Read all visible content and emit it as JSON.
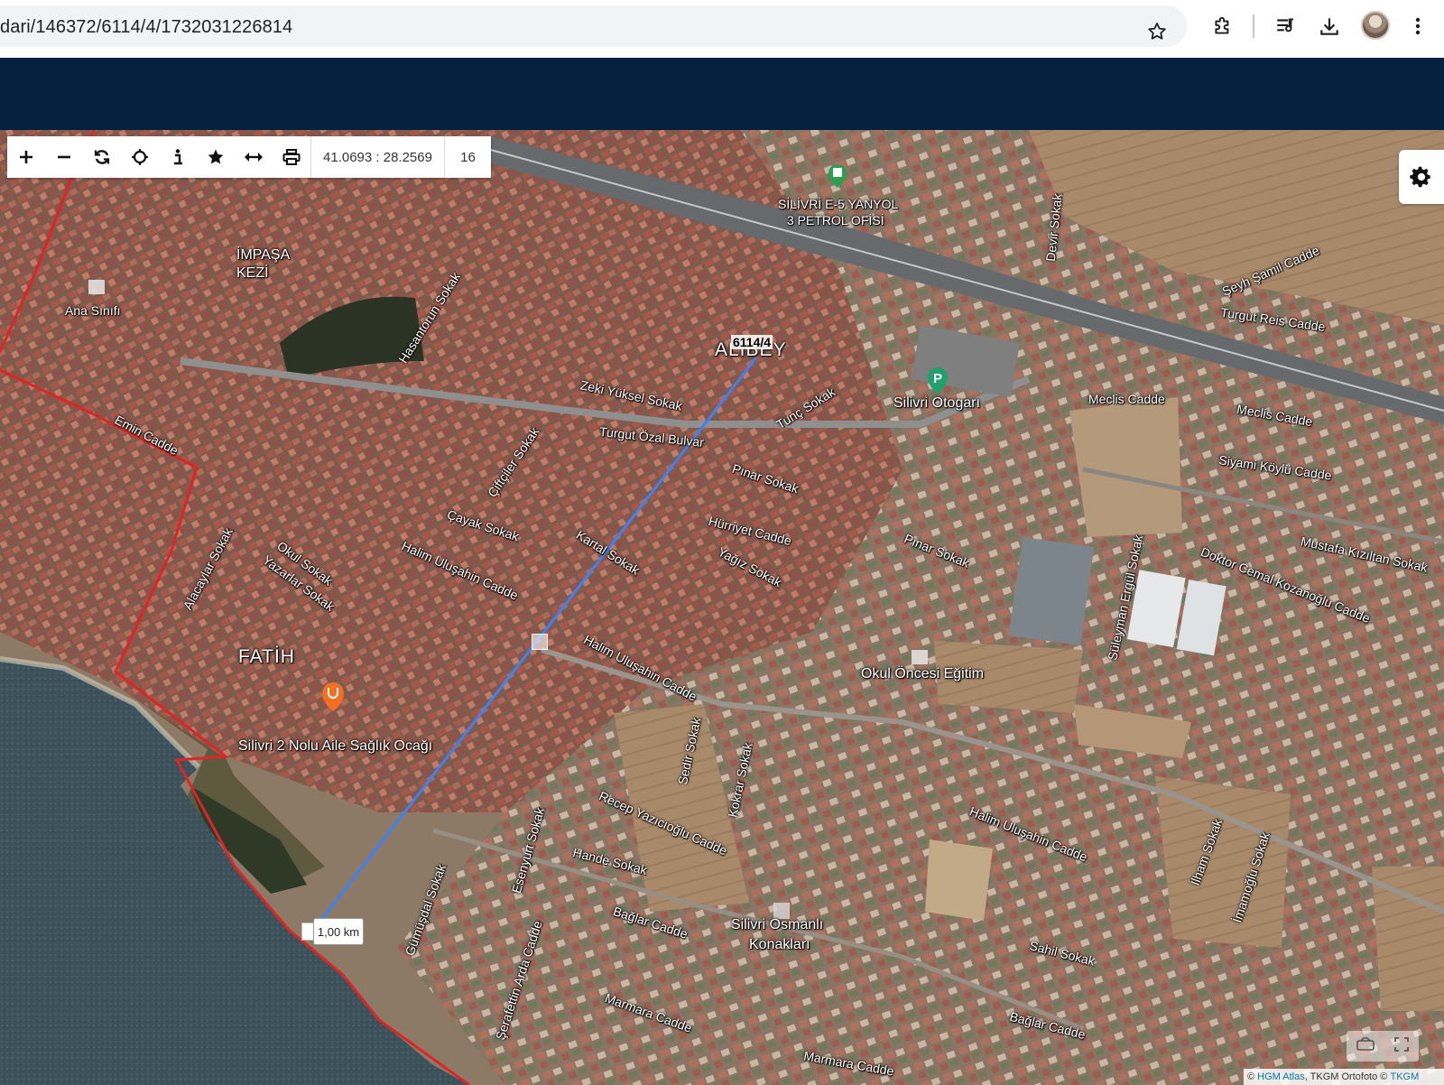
{
  "browser": {
    "url": "dari/146372/6114/4/1732031226814",
    "icons": [
      "bookmark-star-icon",
      "extensions-icon",
      "reading-list-icon",
      "download-icon",
      "profile-avatar",
      "more-menu-icon"
    ]
  },
  "toolbar": {
    "tools": [
      {
        "name": "zoom-in-tool",
        "icon": "plus-icon"
      },
      {
        "name": "zoom-out-tool",
        "icon": "minus-icon"
      },
      {
        "name": "refresh-tool",
        "icon": "refresh-icon"
      },
      {
        "name": "locate-tool",
        "icon": "crosshair-icon"
      },
      {
        "name": "info-tool",
        "icon": "info-icon"
      },
      {
        "name": "favorite-tool",
        "icon": "star-icon"
      },
      {
        "name": "measure-tool",
        "icon": "arrows-horizontal-icon"
      },
      {
        "name": "print-tool",
        "icon": "printer-icon"
      }
    ],
    "coordinates": "41.0693 : 28.2569",
    "zoom_level": "16"
  },
  "map": {
    "parcel_label": "6114/4",
    "distance_label": "1,00 km",
    "labels": {
      "impasa": "İMPAŞA",
      "kezi": "KEZİ",
      "ana_sinifi": "Ana Sınıfı",
      "alibey": "ALİBEY",
      "fatih": "FATİH",
      "saglik": "Silivri 2 Nolu Aile Sağlık Ocağı",
      "petrol1": "SİLİVRİ E-5 YANYOL",
      "petrol2": "3 PETROL OFİSİ",
      "otogar": "Silivri Otogarı",
      "okul_oncesi": "Okul Öncesi Eğitim",
      "osmanli1": "Silivri Osmanlı",
      "osmanli2": "Konakları",
      "turgut_ozal": "Turgut Özal Bulvar",
      "zeki_yuksel": "Zeki Yüksel Sokak",
      "tunc": "Tunç Sokak",
      "pinar": "Pınar Sokak",
      "pinar2": "Pınar Sokak",
      "hurriyet": "Hürriyet Cadde",
      "yagiz": "Yağız Sokak",
      "kartal": "Kartal Sokak",
      "cayak": "Çayak Sokak",
      "halim1": "Halim Uluşahin Cadde",
      "halim2": "Halim Uluşahin Cadde",
      "halim3": "Halim Uluşahin Cadde",
      "ciftciler": "Çiftçiler Sokak",
      "okul_sokak": "Okul Sokak",
      "yazarlar": "Yazarlar Sokak",
      "alacaylar": "Alacaylar Sokak",
      "emin": "Emin Cadde",
      "hasantorun": "Hasantorun Sokak",
      "seyh_samil": "Şeyh Şamil Cadde",
      "turgut_reis": "Turgut Reis Cadde",
      "meclis1": "Meclis Cadde",
      "meclis2": "Meclis Cadde",
      "siyami": "Siyami Köylü Cadde",
      "doktor_cemal": "Doktor Cemal Kozanoğlu Cadde",
      "mustafa": "Mustafa Kızıltan Sokak",
      "recep": "Recep Yazıcıoğlu Cadde",
      "hande": "Hande Sokak",
      "baglar1": "Bağlar Cadde",
      "baglar2": "Bağlar Cadde",
      "sahil": "Sahil Sokak",
      "marmara1": "Marmara Cadde",
      "marmara2": "Marmara Cadde",
      "serafettin": "Şerafettin Arda Cadde",
      "kokrar": "Kokrar Sokak",
      "sedir": "Sedir Sokak",
      "suleyman": "Süleyman Ergül Sokak",
      "ilham": "İlham Sokak",
      "imamoglu": "İmamoğlu Sokak",
      "devir": "Devir Sokak",
      "gumusdal": "Gümüşdal Sokak",
      "esenyurt": "Esenyurt Sokak"
    },
    "attribution_prefix": "© ",
    "attribution_link1": "HGM Atlas",
    "attribution_mid": ", TKGM Ortofoto © ",
    "attribution_link2": "TKGM",
    "colors": {
      "boundary": "#e02424",
      "measure_line": "#3b82f6",
      "sea": "#3b4e57",
      "urban": "#8a5a4a",
      "field": "#9a7a5a",
      "header": "#04223f"
    }
  }
}
